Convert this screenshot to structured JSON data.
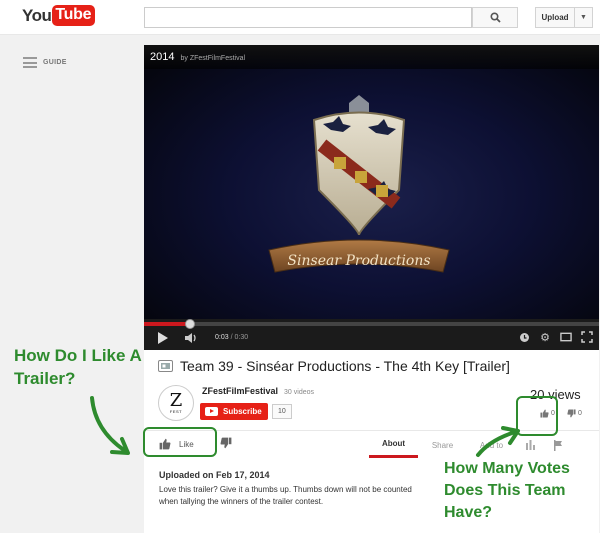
{
  "masthead": {
    "logo_you": "You",
    "logo_tube": "Tube",
    "search_placeholder": "",
    "upload_label": "Upload"
  },
  "guide": {
    "label": "GUIDE"
  },
  "player": {
    "title": "2014",
    "channel": "by ZFestFilmFestival",
    "time_current": "0:03",
    "time_separator": "/",
    "time_total": "0:30",
    "progress_fraction": 0.1,
    "crest_banner_text": "Sinsear Productions"
  },
  "video": {
    "title": "Team 39 - Sinséar Productions - The 4th Key [Trailer]",
    "channel_logo_text": "Z",
    "channel_logo_subtext": "FEST",
    "channel_name": "ZFestFilmFestival",
    "video_count": "30 videos",
    "subscribe_label": "Subscribe",
    "subscriber_count": "10",
    "views": "20 views",
    "like_count": "0",
    "dislike_count": "0",
    "like_label": "Like"
  },
  "tabs": [
    {
      "label": "About",
      "active": true
    },
    {
      "label": "Share",
      "active": false
    },
    {
      "label": "Add to",
      "active": false
    }
  ],
  "description": {
    "uploaded": "Uploaded on Feb 17, 2014",
    "text": "Love this trailer? Give it a thumbs up. Thumbs down will not be counted when tallying the winners of the trailer contest."
  },
  "annotations": {
    "left": "How Do I Like A Trailer?",
    "right": "How Many Votes Does This Team Have?",
    "color": "#2e8b2e"
  },
  "colors": {
    "accent": "#e62117",
    "progress": "#cc181e"
  }
}
